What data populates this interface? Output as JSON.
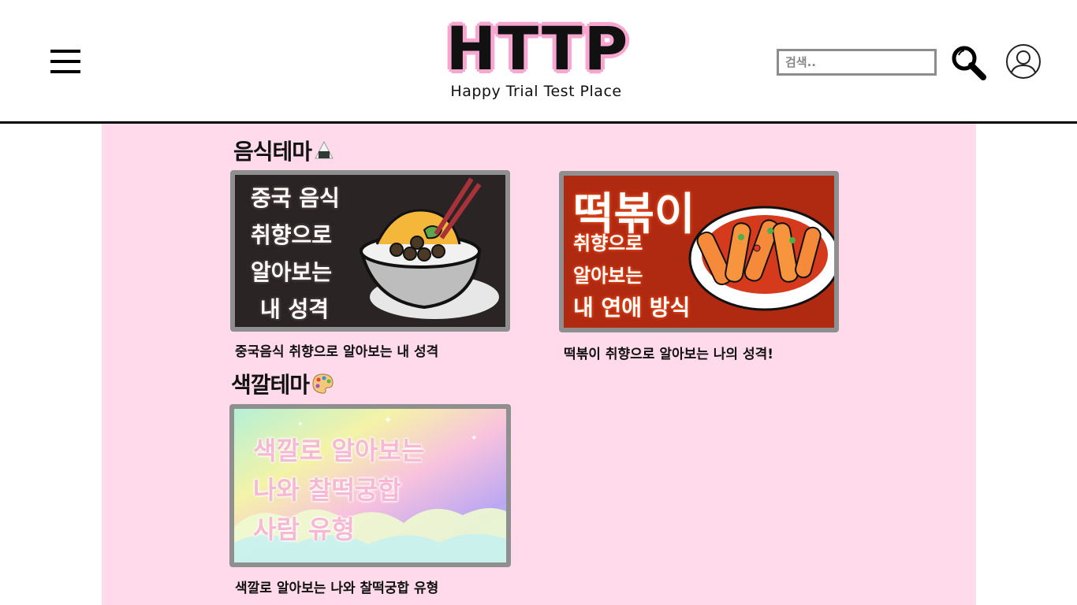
{
  "header": {
    "logo_main": "HTTP",
    "logo_sub": "Happy Trial Test Place",
    "search_placeholder": "검색..",
    "icons": {
      "menu": "hamburger-menu-icon",
      "search": "magnifier-icon",
      "user": "user-profile-icon"
    }
  },
  "colors": {
    "page_bg": "#fedaea",
    "logo_outline": "#f7a6d0",
    "card_border": "#8f8f8f"
  },
  "sections": [
    {
      "title": "음식테마",
      "emoji_icon": "rice-ball-icon",
      "cards": [
        {
          "caption": "중국음식 취향으로 알아보는 내 성격",
          "thumb_lines": [
            "중국 음식",
            "취향으로",
            "알아보는",
            "내 성격"
          ]
        },
        {
          "caption": "떡볶이 취향으로 알아보는 나의 성격!",
          "thumb_lines": [
            "떡볶이",
            "취향으로",
            "알아보는",
            "내 연애 방식"
          ]
        }
      ]
    },
    {
      "title": "색깔테마",
      "emoji_icon": "palette-icon",
      "cards": [
        {
          "caption": "색깔로 알아보는 나와 찰떡궁합 유형",
          "thumb_lines": [
            "색깔로 알아보는",
            "나와 찰떡궁합",
            "사람 유형"
          ]
        }
      ]
    }
  ]
}
